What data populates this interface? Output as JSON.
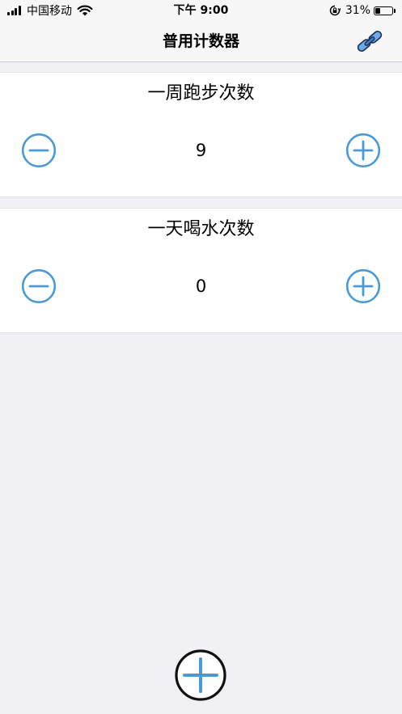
{
  "status_bar": {
    "carrier": "中国移动",
    "time": "下午 9:00",
    "battery_percent": "31%",
    "battery_level": 0.31,
    "icons": [
      "signal-icon",
      "wifi-icon",
      "rotation-lock-icon",
      "battery-icon"
    ]
  },
  "nav": {
    "title": "普用计数器",
    "right_icon": "link-icon"
  },
  "counters": [
    {
      "title": "一周跑步次数",
      "value": "9"
    },
    {
      "title": "一天喝水次数",
      "value": "0"
    }
  ],
  "fab_icon": "plus-icon",
  "colors": {
    "accent": "#4a9ad8",
    "background": "#f0f0f5",
    "card": "#ffffff",
    "fab_ring": "#111111"
  }
}
